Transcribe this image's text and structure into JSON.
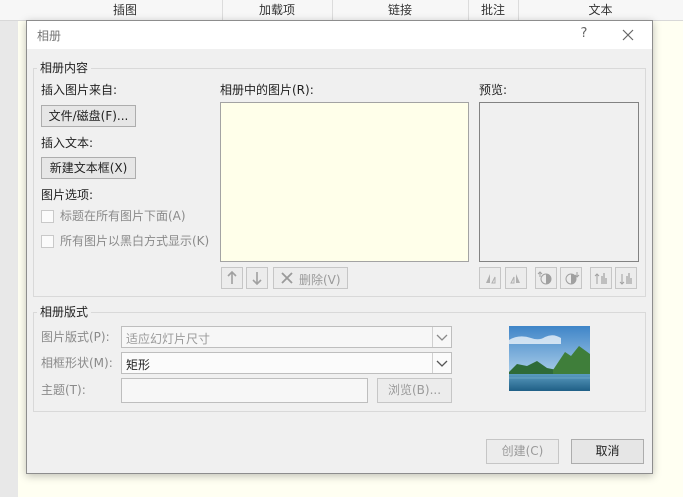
{
  "ribbon": {
    "tabs": [
      "插图",
      "加载项",
      "链接",
      "批注",
      "文本"
    ]
  },
  "dialog": {
    "title": "相册",
    "help": "?",
    "content_group": "相册内容",
    "insert_from_label": "插入图片来自:",
    "file_disk_button": "文件/磁盘(F)...",
    "insert_text_label": "插入文本:",
    "new_textbox_button": "新建文本框(X)",
    "picture_options_label": "图片选项:",
    "option_caption": "标题在所有图片下面(A)",
    "option_bw": "所有图片以黑白方式显示(K)",
    "pictures_in_album_label": "相册中的图片(R):",
    "preview_label": "预览:",
    "delete_button": "删除(V)",
    "layout_group": "相册版式",
    "picture_layout_label": "图片版式(P):",
    "picture_layout_value": "适应幻灯片尺寸",
    "frame_shape_label": "相框形状(M):",
    "frame_shape_value": "矩形",
    "theme_label": "主题(T):",
    "browse_button": "浏览(B)...",
    "create_button": "创建(C)",
    "cancel_button": "取消"
  },
  "colors": {
    "list_bg": "#ffffea",
    "dialog_bg": "#f0f0f0",
    "disabled_text": "#9a9a9a"
  }
}
